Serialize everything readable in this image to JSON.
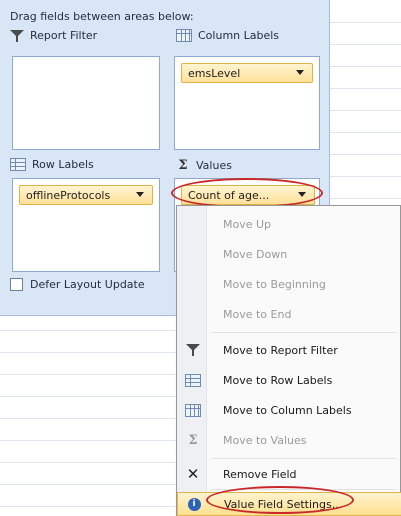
{
  "field_list": {
    "drag_label": "Drag fields between areas below:",
    "report_filter_label": "Report Filter",
    "column_labels_label": "Column Labels",
    "row_labels_label": "Row Labels",
    "values_label": "Values",
    "column_field": "emsLevel",
    "row_field": "offlineProtocols",
    "value_field": "Count of age...",
    "defer_label": "Defer Layout Update",
    "defer_checked": false
  },
  "context_menu": {
    "items": [
      {
        "label": "Move Up",
        "enabled": false,
        "icon": "none"
      },
      {
        "label": "Move Down",
        "enabled": false,
        "icon": "none"
      },
      {
        "label": "Move to Beginning",
        "enabled": false,
        "icon": "none"
      },
      {
        "label": "Move to End",
        "enabled": false,
        "icon": "none"
      },
      {
        "label": "Move to Report Filter",
        "enabled": true,
        "icon": "filter-icon"
      },
      {
        "label": "Move to Row Labels",
        "enabled": true,
        "icon": "row-labels-icon"
      },
      {
        "label": "Move to Column Labels",
        "enabled": true,
        "icon": "column-labels-icon"
      },
      {
        "label": "Move to Values",
        "enabled": false,
        "icon": "sigma-icon"
      },
      {
        "label": "Remove Field",
        "enabled": true,
        "icon": "remove-icon"
      },
      {
        "label": "Value Field Settings...",
        "enabled": true,
        "icon": "value-settings-icon",
        "highlighted": true
      }
    ]
  },
  "colors": {
    "panel_bg": "#d8e6f6",
    "field_pill": "#ffe09a",
    "highlight_ring": "#c8282a",
    "menu_hover": "#ffe08f"
  }
}
